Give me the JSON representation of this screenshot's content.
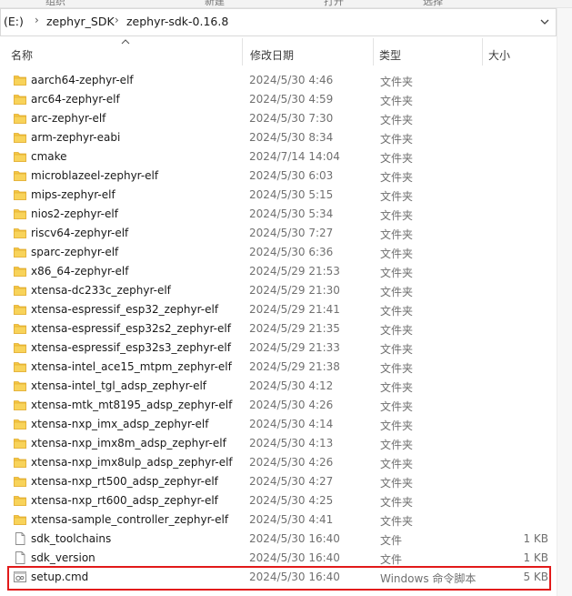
{
  "toolbar_strip": [
    "组织",
    "新建",
    "打开",
    "选择"
  ],
  "address_bar": {
    "drive": "(E:)",
    "path": [
      "zephyr_SDK",
      "zephyr-sdk-0.16.8"
    ],
    "separator": "›"
  },
  "columns": {
    "name": "名称",
    "date": "修改日期",
    "type": "类型",
    "size": "大小"
  },
  "files": [
    {
      "name": "aarch64-zephyr-elf",
      "date": "2024/5/30 4:46",
      "type": "文件夹",
      "size": "",
      "icon": "folder-icon"
    },
    {
      "name": "arc64-zephyr-elf",
      "date": "2024/5/30 4:59",
      "type": "文件夹",
      "size": "",
      "icon": "folder-icon"
    },
    {
      "name": "arc-zephyr-elf",
      "date": "2024/5/30 7:30",
      "type": "文件夹",
      "size": "",
      "icon": "folder-icon"
    },
    {
      "name": "arm-zephyr-eabi",
      "date": "2024/5/30 8:34",
      "type": "文件夹",
      "size": "",
      "icon": "folder-icon"
    },
    {
      "name": "cmake",
      "date": "2024/7/14 14:04",
      "type": "文件夹",
      "size": "",
      "icon": "folder-icon"
    },
    {
      "name": "microblazeel-zephyr-elf",
      "date": "2024/5/30 6:03",
      "type": "文件夹",
      "size": "",
      "icon": "folder-icon"
    },
    {
      "name": "mips-zephyr-elf",
      "date": "2024/5/30 5:15",
      "type": "文件夹",
      "size": "",
      "icon": "folder-icon"
    },
    {
      "name": "nios2-zephyr-elf",
      "date": "2024/5/30 5:34",
      "type": "文件夹",
      "size": "",
      "icon": "folder-icon"
    },
    {
      "name": "riscv64-zephyr-elf",
      "date": "2024/5/30 7:27",
      "type": "文件夹",
      "size": "",
      "icon": "folder-icon"
    },
    {
      "name": "sparc-zephyr-elf",
      "date": "2024/5/30 6:36",
      "type": "文件夹",
      "size": "",
      "icon": "folder-icon"
    },
    {
      "name": "x86_64-zephyr-elf",
      "date": "2024/5/29 21:53",
      "type": "文件夹",
      "size": "",
      "icon": "folder-icon"
    },
    {
      "name": "xtensa-dc233c_zephyr-elf",
      "date": "2024/5/29 21:30",
      "type": "文件夹",
      "size": "",
      "icon": "folder-icon"
    },
    {
      "name": "xtensa-espressif_esp32_zephyr-elf",
      "date": "2024/5/29 21:41",
      "type": "文件夹",
      "size": "",
      "icon": "folder-icon"
    },
    {
      "name": "xtensa-espressif_esp32s2_zephyr-elf",
      "date": "2024/5/29 21:35",
      "type": "文件夹",
      "size": "",
      "icon": "folder-icon"
    },
    {
      "name": "xtensa-espressif_esp32s3_zephyr-elf",
      "date": "2024/5/29 21:33",
      "type": "文件夹",
      "size": "",
      "icon": "folder-icon"
    },
    {
      "name": "xtensa-intel_ace15_mtpm_zephyr-elf",
      "date": "2024/5/29 21:38",
      "type": "文件夹",
      "size": "",
      "icon": "folder-icon"
    },
    {
      "name": "xtensa-intel_tgl_adsp_zephyr-elf",
      "date": "2024/5/30 4:12",
      "type": "文件夹",
      "size": "",
      "icon": "folder-icon"
    },
    {
      "name": "xtensa-mtk_mt8195_adsp_zephyr-elf",
      "date": "2024/5/30 4:26",
      "type": "文件夹",
      "size": "",
      "icon": "folder-icon"
    },
    {
      "name": "xtensa-nxp_imx_adsp_zephyr-elf",
      "date": "2024/5/30 4:14",
      "type": "文件夹",
      "size": "",
      "icon": "folder-icon"
    },
    {
      "name": "xtensa-nxp_imx8m_adsp_zephyr-elf",
      "date": "2024/5/30 4:13",
      "type": "文件夹",
      "size": "",
      "icon": "folder-icon"
    },
    {
      "name": "xtensa-nxp_imx8ulp_adsp_zephyr-elf",
      "date": "2024/5/30 4:26",
      "type": "文件夹",
      "size": "",
      "icon": "folder-icon"
    },
    {
      "name": "xtensa-nxp_rt500_adsp_zephyr-elf",
      "date": "2024/5/30 4:27",
      "type": "文件夹",
      "size": "",
      "icon": "folder-icon"
    },
    {
      "name": "xtensa-nxp_rt600_adsp_zephyr-elf",
      "date": "2024/5/30 4:25",
      "type": "文件夹",
      "size": "",
      "icon": "folder-icon"
    },
    {
      "name": "xtensa-sample_controller_zephyr-elf",
      "date": "2024/5/30 4:41",
      "type": "文件夹",
      "size": "",
      "icon": "folder-icon"
    },
    {
      "name": "sdk_toolchains",
      "date": "2024/5/30 16:40",
      "type": "文件",
      "size": "1 KB",
      "icon": "file-icon"
    },
    {
      "name": "sdk_version",
      "date": "2024/5/30 16:40",
      "type": "文件",
      "size": "1 KB",
      "icon": "file-icon"
    },
    {
      "name": "setup.cmd",
      "date": "2024/5/30 16:40",
      "type": "Windows 命令脚本",
      "size": "5 KB",
      "icon": "cmd-script-icon"
    }
  ],
  "colors": {
    "folder": "#f5c842",
    "folder_dark": "#e0a92b",
    "highlight_border": "#e21a1a"
  }
}
